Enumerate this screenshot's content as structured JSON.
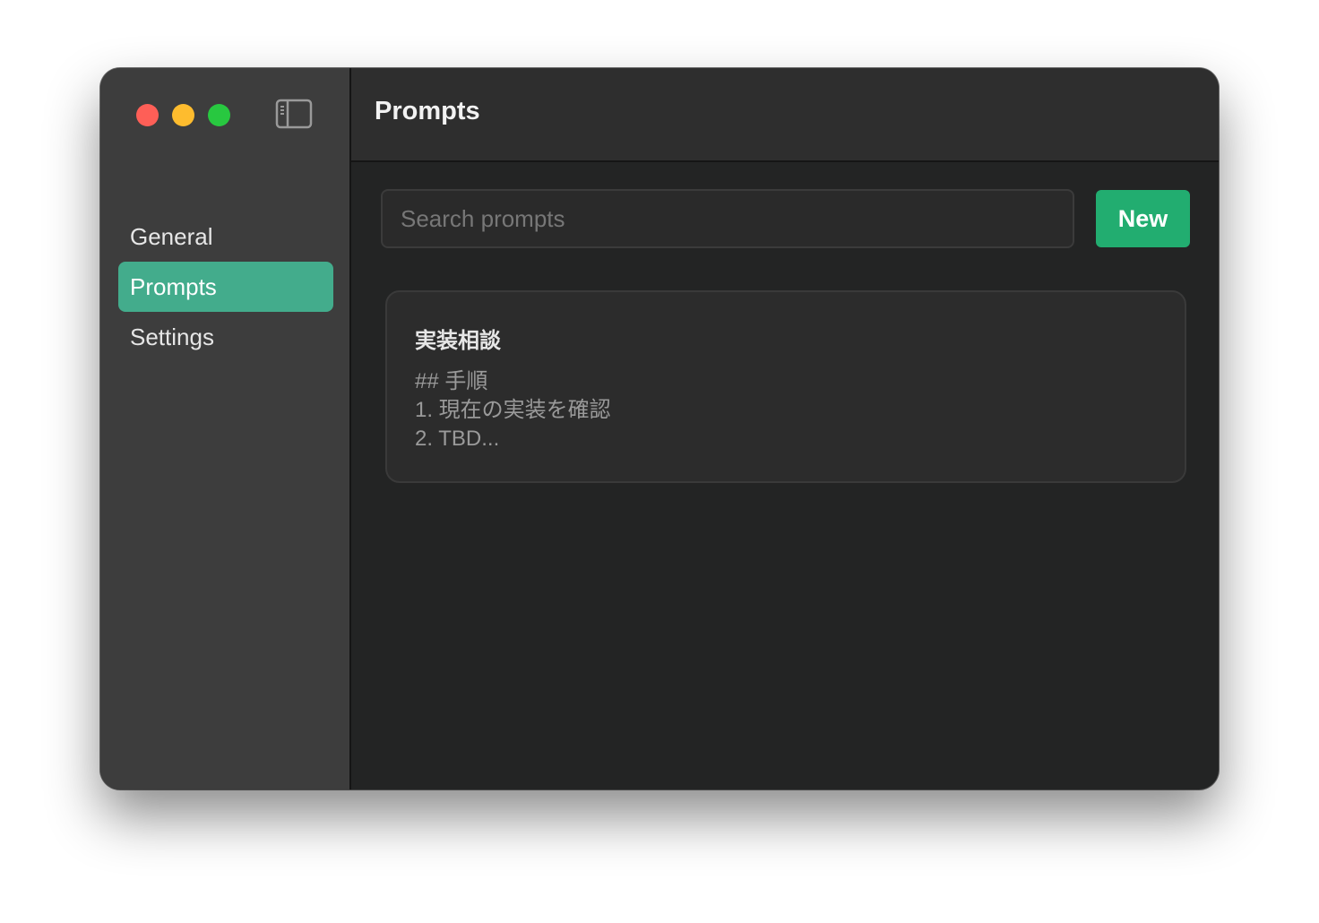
{
  "window": {
    "controls": [
      "close",
      "minimize",
      "zoom"
    ],
    "sidebar_toggle_icon": "sidebar-left-icon"
  },
  "sidebar": {
    "items": [
      {
        "label": "General",
        "active": false
      },
      {
        "label": "Prompts",
        "active": true
      },
      {
        "label": "Settings",
        "active": false
      }
    ]
  },
  "header": {
    "title": "Prompts"
  },
  "search": {
    "placeholder": "Search prompts",
    "value": ""
  },
  "toolbar": {
    "new_label": "New"
  },
  "prompts": [
    {
      "title": "実装相談",
      "preview_lines": [
        "## 手順",
        "1. 現在の実装を確認",
        "2. TBD..."
      ]
    }
  ],
  "colors": {
    "accent": "#43ac8c",
    "new_button": "#22ad70",
    "close": "#fe5f57",
    "minimize": "#febc2e",
    "zoom": "#28c840"
  }
}
